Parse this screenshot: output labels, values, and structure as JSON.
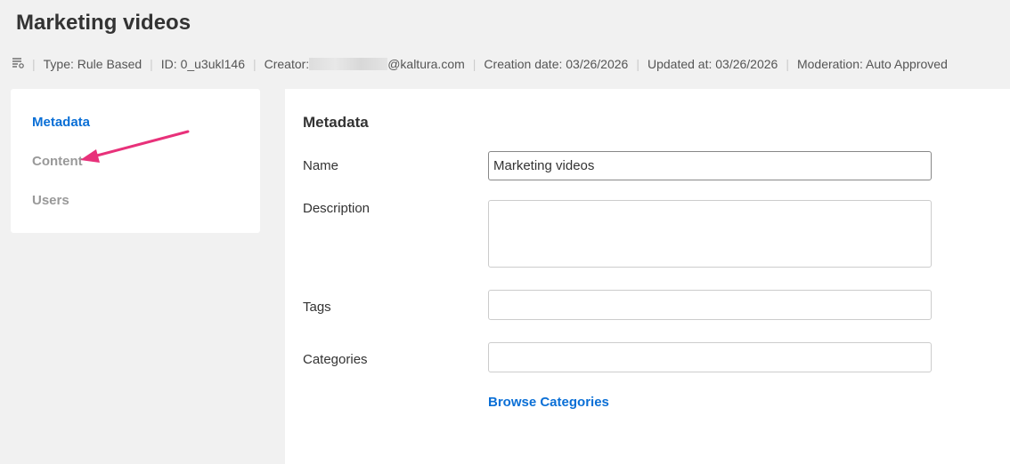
{
  "title": "Marketing videos",
  "meta": {
    "icon": "playlist-rule-icon",
    "type": "Type: Rule Based",
    "id": "ID: 0_u3ukl146",
    "creator_label": "Creator:",
    "creator_domain": "@kaltura.com",
    "created": "Creation date: 03/26/2026",
    "updated": "Updated at: 03/26/2026",
    "moderation": "Moderation: Auto Approved"
  },
  "sidebar": {
    "items": [
      {
        "label": "Metadata",
        "active": true
      },
      {
        "label": "Content"
      },
      {
        "label": "Users"
      }
    ],
    "active_color": "#0a6fd6"
  },
  "form": {
    "heading": "Metadata",
    "name_label": "Name",
    "name_value": "Marketing videos",
    "description_label": "Description",
    "description_value": "",
    "tags_label": "Tags",
    "tags_value": "",
    "categories_label": "Categories",
    "categories_value": "",
    "browse": "Browse Categories"
  },
  "annotation": {
    "arrow_color": "#e8317a"
  }
}
